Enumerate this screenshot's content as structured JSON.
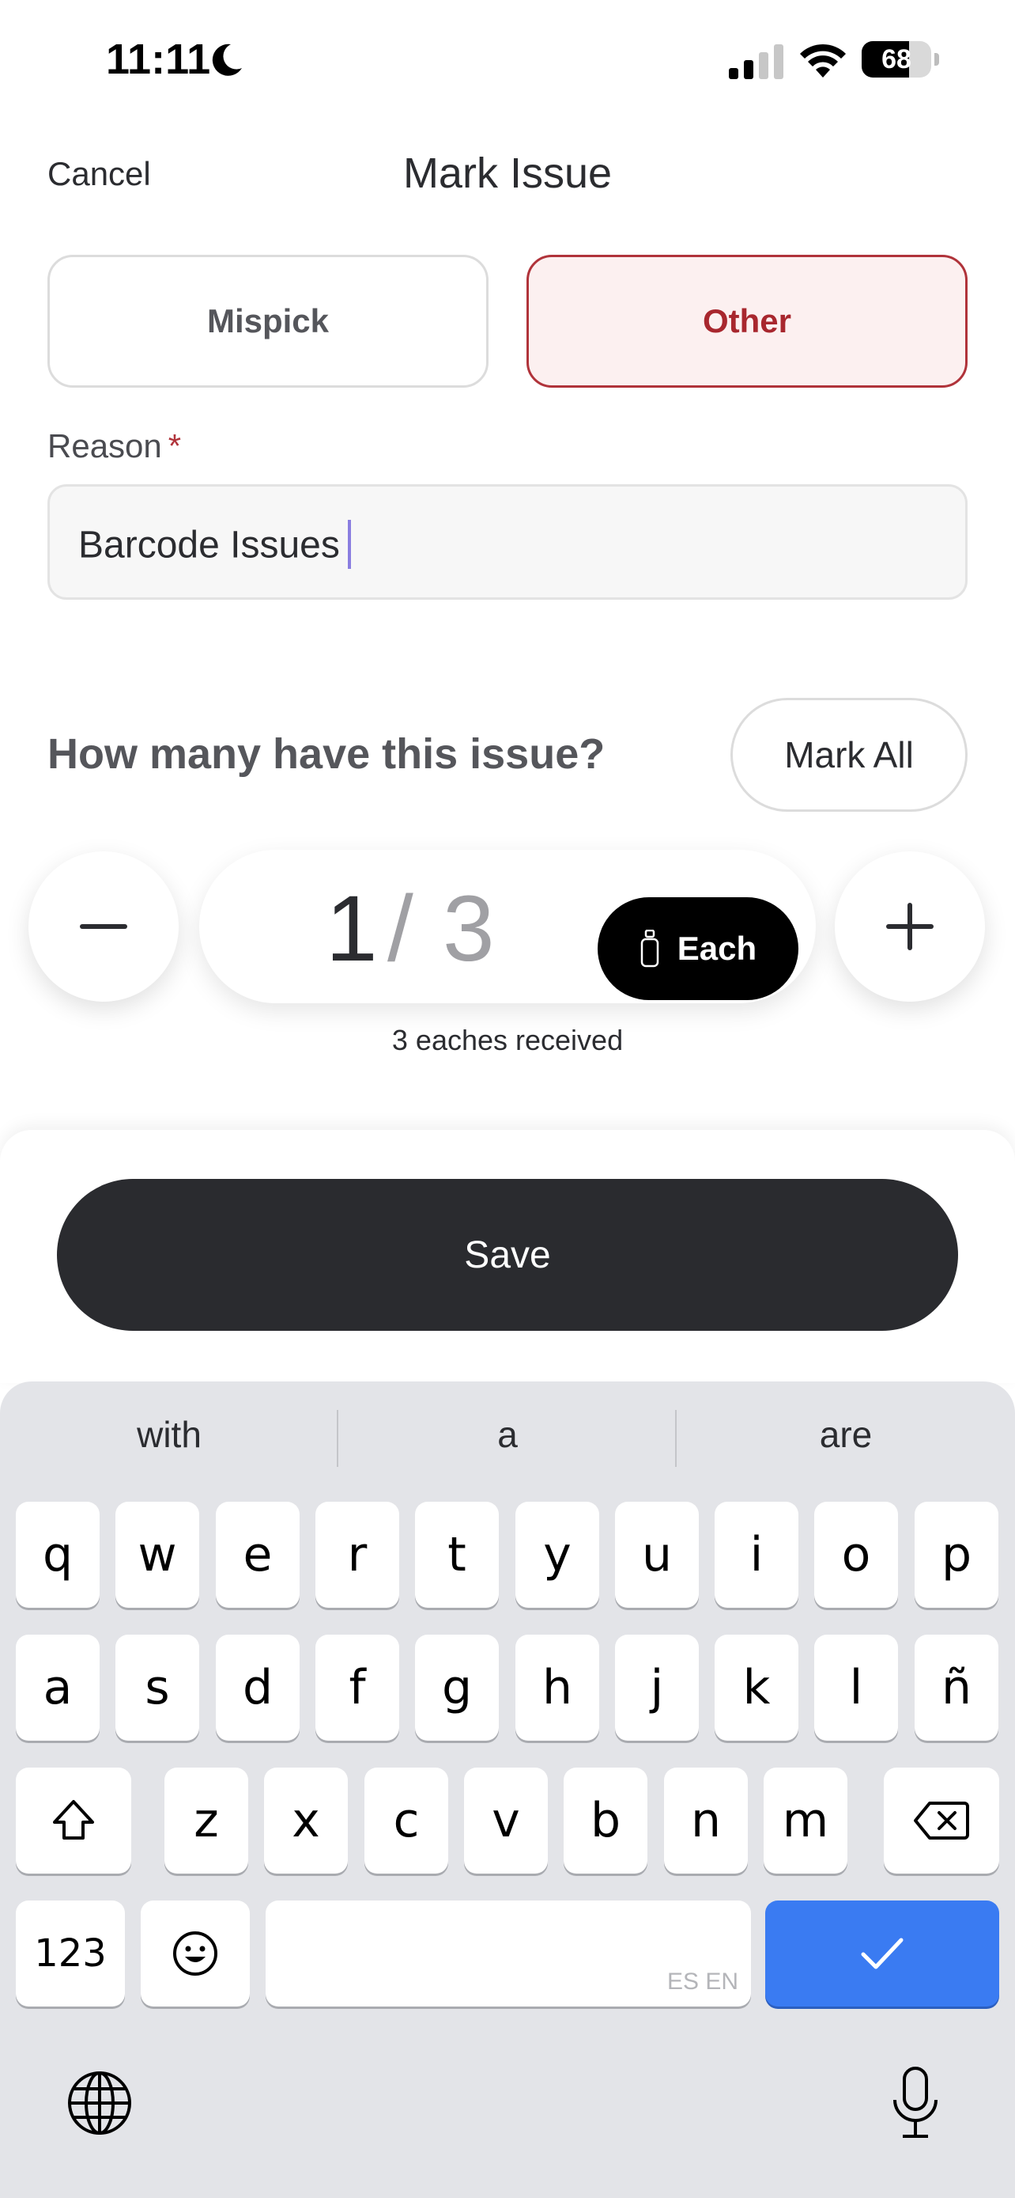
{
  "status_bar": {
    "time": "11:11",
    "battery": "68",
    "battery_level": 0.68
  },
  "header": {
    "cancel_label": "Cancel",
    "title": "Mark Issue"
  },
  "issue_types": {
    "mispick_label": "Mispick",
    "other_label": "Other",
    "selected": "Other"
  },
  "reason": {
    "label": "Reason",
    "required_mark": "*",
    "value": "Barcode Issues"
  },
  "quantity": {
    "question": "How many have this issue?",
    "mark_all_label": "Mark All",
    "value": "1",
    "separator": "/",
    "total": "3",
    "unit_label": "Each",
    "caption": "3 eaches received"
  },
  "footer": {
    "save_label": "Save"
  },
  "keyboard": {
    "suggestions": [
      "with",
      "a",
      "are"
    ],
    "row1": [
      "q",
      "w",
      "e",
      "r",
      "t",
      "y",
      "u",
      "i",
      "o",
      "p"
    ],
    "row2": [
      "a",
      "s",
      "d",
      "f",
      "g",
      "h",
      "j",
      "k",
      "l",
      "ñ"
    ],
    "row3": [
      "z",
      "x",
      "c",
      "v",
      "b",
      "n",
      "m"
    ],
    "numbers_label": "123",
    "space_languages": "ES EN",
    "done_color": "#3a7bf2"
  },
  "colors": {
    "accent_red": "#a8272e",
    "accent_red_bg": "#fcf0f0",
    "primary_dark": "#2a2b2f"
  }
}
